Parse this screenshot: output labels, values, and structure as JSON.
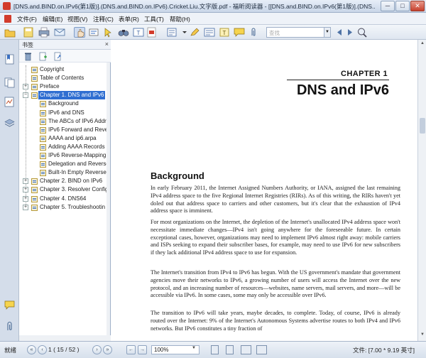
{
  "window": {
    "title": "[DNS.and.BIND.on.IPv6(第1版)].(DNS.and.BIND.on.IPv6).Cricket.Liu.文字版.pdf - 福昕阅读器 - [[DNS.and.BIND.on.IPv6(第1版)].(DNS...",
    "minimize_label": "─",
    "maximize_label": "□",
    "close_label": "✕"
  },
  "menu": {
    "items": [
      {
        "label": "文件(F)"
      },
      {
        "label": "编辑(E)"
      },
      {
        "label": "视图(V)"
      },
      {
        "label": "注释(C)"
      },
      {
        "label": "表单(R)"
      },
      {
        "label": "工具(T)"
      },
      {
        "label": "帮助(H)"
      }
    ]
  },
  "toolbar": {
    "search_placeholder": "查找",
    "search_drop": "▼",
    "icons": [
      "open-icon",
      "save-icon",
      "print-icon",
      "email-icon",
      "hand-tool-icon",
      "select-text-icon",
      "snapshot-icon",
      "find-icon",
      "typewriter-icon",
      "pdf-icon",
      "note-icon",
      "highlight-icon",
      "callout-icon",
      "textbox-icon",
      "comment-icon",
      "attach-icon",
      "prev-search-icon",
      "next-search-icon",
      "zoom-search-icon"
    ]
  },
  "bookmarks": {
    "title": "书签",
    "close": "×",
    "items": [
      {
        "label": "Copyright",
        "level": 0,
        "expander": ""
      },
      {
        "label": "Table of Contents",
        "level": 0,
        "expander": ""
      },
      {
        "label": "Preface",
        "level": 0,
        "expander": "+"
      },
      {
        "label": "Chapter 1. DNS and IPv6",
        "level": 0,
        "expander": "−",
        "selected": true
      },
      {
        "label": "Background",
        "level": 1,
        "expander": ""
      },
      {
        "label": "IPv6 and DNS",
        "level": 1,
        "expander": ""
      },
      {
        "label": "The ABCs of IPv6 Addr",
        "level": 1,
        "expander": ""
      },
      {
        "label": "IPv6 Forward and Reve",
        "level": 1,
        "expander": ""
      },
      {
        "label": "AAAA and ip6.arpa",
        "level": 1,
        "expander": ""
      },
      {
        "label": "Adding AAAA Records",
        "level": 1,
        "expander": ""
      },
      {
        "label": "IPv6 Reverse-Mapping Z",
        "level": 1,
        "expander": ""
      },
      {
        "label": "Delegation and Reverse",
        "level": 1,
        "expander": ""
      },
      {
        "label": "Built-In Empty Reverse",
        "level": 1,
        "expander": ""
      },
      {
        "label": "Chapter 2. BIND on IPv6",
        "level": 0,
        "expander": "+"
      },
      {
        "label": "Chapter 3. Resolver Config",
        "level": 0,
        "expander": "+"
      },
      {
        "label": "Chapter 4. DNS64",
        "level": 0,
        "expander": "+"
      },
      {
        "label": "Chapter 5. Troubleshootin",
        "level": 0,
        "expander": "+"
      }
    ]
  },
  "document": {
    "chapter_number": "CHAPTER 1",
    "chapter_title": "DNS and IPv6",
    "section_title": "Background",
    "paragraphs": [
      "In early February 2011, the Internet Assigned Numbers Authority, or IANA, assigned the last remaining IPv4 address space to the five Regional Internet Registries (RIRs). As of this writing, the RIRs haven't yet doled out that address space to carriers and other customers, but it's clear that the exhaustion of IPv4 address space is imminent.",
      "For most organizations on the Internet, the depletion of the Internet's unallocated IPv4 address space won't necessitate immediate changes—IPv4 isn't going anywhere for the foreseeable future. In certain exceptional cases, however, organizations may need to implement IPv6 almost right away: mobile carriers and ISPs seeking to expand their subscriber bases, for example, may need to use IPv6 for new subscribers if they lack additional IPv4 address space to use for expansion.",
      "The Internet's transition from IPv4 to IPv6 has begun. With the US government's mandate that government agencies move their networks to IPv6, a growing number of users will access the Internet over the new protocol, and an increasing number of resources—websites, name servers, mail servers, and more—will be accessible via IPv6. In some cases, some may only be accessible over IPv6.",
      "The transition to IPv6 will take years, maybe decades, to complete. Today, of course, IPv6 is already routed over the Internet: 9% of the Internet's Autonomous Systems advertise routes to both IPv4 and IPv6 networks. But IPv6 constitutes a tiny fraction of"
    ]
  },
  "status": {
    "ready": "就绪",
    "page_indicator": "1 ( 15 / 52 )",
    "zoom": "100%",
    "page_size": "文件: [7.00 * 9.19 英寸]"
  }
}
